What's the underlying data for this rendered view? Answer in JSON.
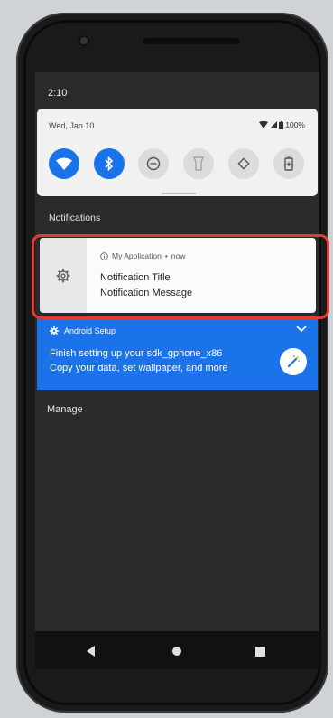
{
  "status_bar": {
    "time": "2:10"
  },
  "quick_settings": {
    "date": "Wed, Jan 10",
    "battery": "100%",
    "tiles": [
      {
        "icon": "wifi-icon",
        "state": "on"
      },
      {
        "icon": "bluetooth-icon",
        "state": "on"
      },
      {
        "icon": "do-not-disturb-icon",
        "state": "off"
      },
      {
        "icon": "flashlight-icon",
        "state": "off"
      },
      {
        "icon": "auto-rotate-icon",
        "state": "off"
      },
      {
        "icon": "battery-saver-icon",
        "state": "off"
      }
    ]
  },
  "notifications_header": "Notifications",
  "notification": {
    "app_name": "My Application",
    "separator": "•",
    "time": "now",
    "title": "Notification Title",
    "message": "Notification Message",
    "icon": "gear-icon"
  },
  "setup_notification": {
    "app_name": "Android Setup",
    "line1": "Finish setting up your sdk_gphone_x86",
    "line2": "Copy your data, set wallpaper, and more",
    "icon": "magic-wand-icon"
  },
  "manage_label": "Manage",
  "colors": {
    "accent": "#1a73e8",
    "highlight": "#e53935",
    "shade": "#2a2a2a",
    "card": "#f1f1f1"
  }
}
